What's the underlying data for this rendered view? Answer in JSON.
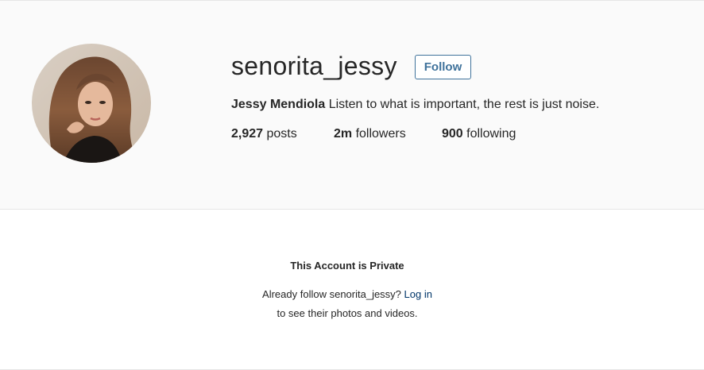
{
  "profile": {
    "username": "senorita_jessy",
    "follow_label": "Follow",
    "full_name": "Jessy Mendiola",
    "bio": " Listen to what is important, the rest is just noise.",
    "stats": {
      "posts_count": "2,927",
      "posts_label": " posts",
      "followers_count": "2m",
      "followers_label": " followers",
      "following_count": "900",
      "following_label": " following"
    },
    "colors": {
      "accent": "#3f729b",
      "header_bg": "#fafafa",
      "link": "#003569"
    }
  },
  "private_notice": {
    "title": "This Account is Private",
    "line1_prefix": "Already follow senorita_jessy? ",
    "login_label": "Log in",
    "line2": "to see their photos and videos."
  }
}
